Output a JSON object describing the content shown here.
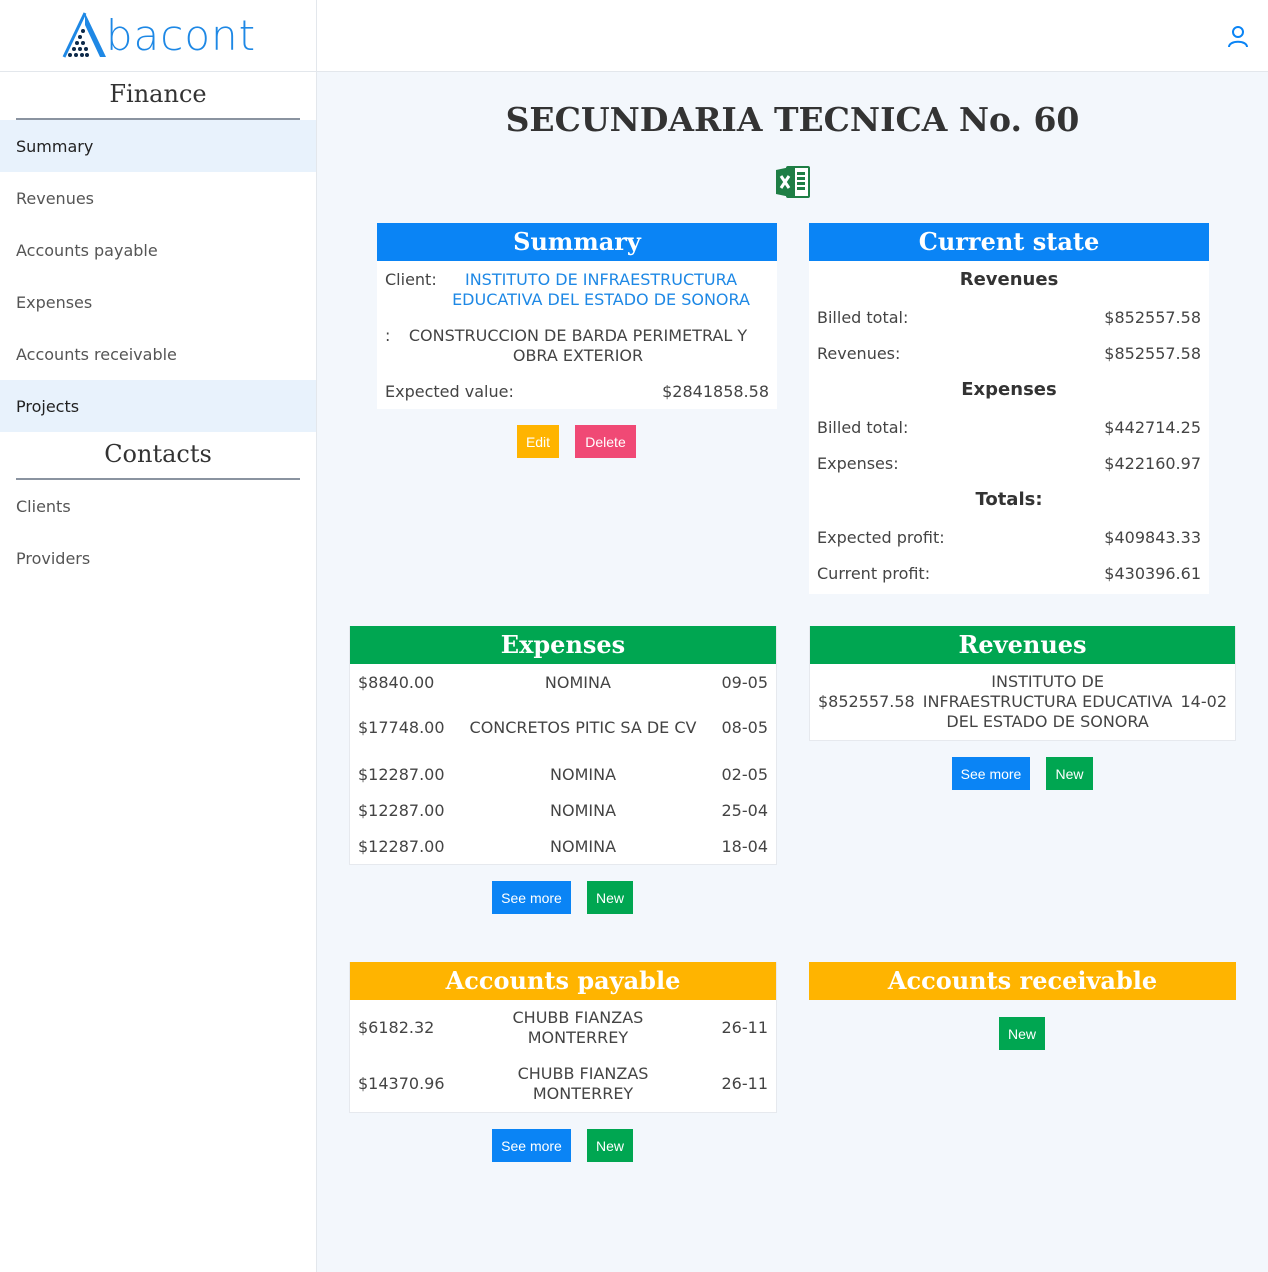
{
  "app": {
    "logo_text": "bacont"
  },
  "sidebar": {
    "finance_title": "Finance",
    "finance_items": [
      {
        "label": "Summary"
      },
      {
        "label": "Revenues"
      },
      {
        "label": "Accounts payable"
      },
      {
        "label": "Expenses"
      },
      {
        "label": "Accounts receivable"
      },
      {
        "label": "Projects"
      }
    ],
    "contacts_title": "Contacts",
    "contacts_items": [
      {
        "label": "Clients"
      },
      {
        "label": "Providers"
      }
    ]
  },
  "page": {
    "title": "SECUNDARIA TECNICA No. 60"
  },
  "summary": {
    "header": "Summary",
    "client_label": "Client:",
    "client_value": "INSTITUTO DE INFRAESTRUCTURA EDUCATIVA DEL ESTADO DE SONORA",
    "desc_label": ":",
    "desc_value": "CONSTRUCCION DE BARDA PERIMETRAL Y OBRA EXTERIOR",
    "expected_label": "Expected value:",
    "expected_value": "$2841858.58",
    "edit_label": "Edit",
    "delete_label": "Delete"
  },
  "current_state": {
    "header": "Current state",
    "revenues_title": "Revenues",
    "rev_billed_label": "Billed total:",
    "rev_billed_value": "$852557.58",
    "rev_label": "Revenues:",
    "rev_value": "$852557.58",
    "expenses_title": "Expenses",
    "exp_billed_label": "Billed total:",
    "exp_billed_value": "$442714.25",
    "exp_label": "Expenses:",
    "exp_value": "$422160.97",
    "totals_title": "Totals:",
    "expected_profit_label": "Expected profit:",
    "expected_profit_value": "$409843.33",
    "current_profit_label": "Current profit:",
    "current_profit_value": "$430396.61"
  },
  "expenses": {
    "header": "Expenses",
    "rows": [
      {
        "amount": "$8840.00",
        "name": "NOMINA",
        "date": "09-05"
      },
      {
        "amount": "$17748.00",
        "name": "CONCRETOS PITIC SA DE CV",
        "date": "08-05"
      },
      {
        "amount": "$12287.00",
        "name": "NOMINA",
        "date": "02-05"
      },
      {
        "amount": "$12287.00",
        "name": "NOMINA",
        "date": "25-04"
      },
      {
        "amount": "$12287.00",
        "name": "NOMINA",
        "date": "18-04"
      }
    ],
    "see_more_label": "See more",
    "new_label": "New"
  },
  "revenues": {
    "header": "Revenues",
    "rows": [
      {
        "amount": "$852557.58",
        "name": "INSTITUTO DE INFRAESTRUCTURA EDUCATIVA DEL ESTADO DE SONORA",
        "date": "14-02"
      }
    ],
    "see_more_label": "See more",
    "new_label": "New"
  },
  "accounts_payable": {
    "header": "Accounts payable",
    "rows": [
      {
        "amount": "$6182.32",
        "name": "CHUBB FIANZAS MONTERREY",
        "date": "26-11"
      },
      {
        "amount": "$14370.96",
        "name": "CHUBB FIANZAS MONTERREY",
        "date": "26-11"
      }
    ],
    "see_more_label": "See more",
    "new_label": "New"
  },
  "accounts_receivable": {
    "header": "Accounts receivable",
    "new_label": "New"
  },
  "colors": {
    "blue": "#0a84f5",
    "green": "#00a651",
    "yellow": "#ffb400",
    "pink": "#f04975"
  }
}
